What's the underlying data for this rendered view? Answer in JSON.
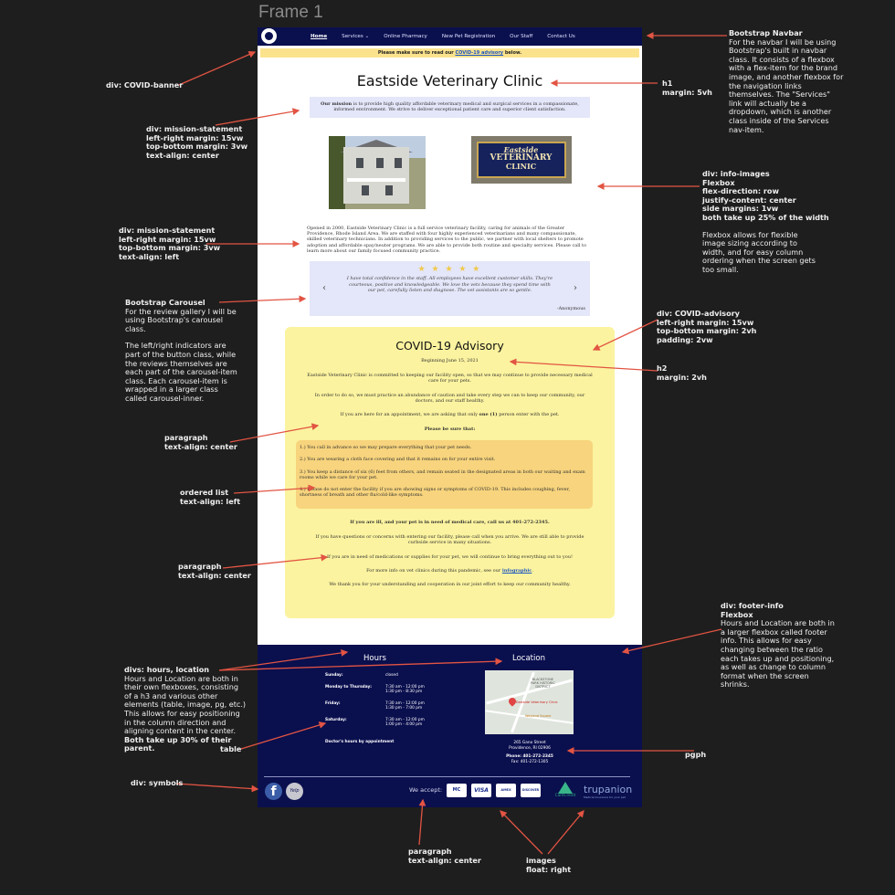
{
  "frame_title": "Frame 1",
  "site": {
    "nav": {
      "links": [
        "Home",
        "Services",
        "Online Pharmacy",
        "New Pet Registration",
        "Our Staff",
        "Contact Us"
      ]
    },
    "banner": {
      "prefix": "Please make sure to read our ",
      "link": "COVID-19 advisory",
      "suffix": " below."
    },
    "title": "Eastside Veterinary Clinic",
    "mission_label": "Our mission",
    "mission_text": " is to provide high quality affordable veterinary medical and surgical services in a compassionate, informed environment. We strive to deliver exceptional patient care and superior client satisfaction.",
    "sign": {
      "line1": "Eastside",
      "line2": "VETERINARY",
      "line3": "CLINIC"
    },
    "about": "Opened in 2000, Eastside Veterinary Clinic is a full service veterinary facility, caring for animals of the Greater Providence, Rhode Island Area. We are staffed with four highly experienced veterinarians and many compassionate, skilled veterinary technicians. In addition to providing services to the public, we partner with local shelters to promote adoption and affordable spay/neuter programs. We are able to provide both routine and specialty services. Please call to learn more about our family focused community practice.",
    "review": {
      "stars": "★ ★ ★ ★ ★",
      "quote": "I have total confidence in the staff. All employees have excellent customer skills. They're courteous, positive and knowledgeable. We love the vets because they spend time with our pet, carefully listen and diagnose. The vet assistants are so gentle.",
      "author": "-Anonymous"
    },
    "advisory": {
      "title": "COVID-19 Advisory",
      "date": "Beginning June 15, 2021",
      "p1": "Eastside Veterinary Clinic is committed to keeping our facility open, so that we may continue to provide necessary medical care for your pets.",
      "p2": "In order to do so, we must practice an abundance of caution and take every step we can to keep our community, our doctors, and our staff healthy.",
      "p3a": "If you are here for an appointment, we are asking that only ",
      "p3b": "one (1)",
      "p3c": " person enter with the pet.",
      "p4": "Please be sure that:",
      "list": [
        "1.) You call in advance so we may prepare everything that your pet needs.",
        "2.) You are wearing a cloth face covering and that it remains on for your entire visit.",
        "3.) You keep a distance of six (6) feet from others, and remain seated in the designated areas in both our waiting and exam rooms while we care for your pet.",
        "4.) Please do not enter the facility if you are showing signs or symptoms of COVID-19. This includes coughing, fever, shortness of breath and other flu/cold-like symptoms."
      ],
      "p5": "If you are ill, and your pet is in need of medical care, call us at 401-272-2345.",
      "p6": "If you have questions or concerns with entering our facility, please call when you arrive. We are still able to provide curbside service in many situations.",
      "p7": "If you are in need of medications or supplies for your pet, we will continue to bring everything out to you!",
      "p8a": "For more info on vet clinics during this pandemic, see our ",
      "p8b": "infographic",
      "p8c": ".",
      "p9": "We thank you for your understanding and cooperation in our joint effort to keep our community healthy."
    },
    "footer": {
      "hours_title": "Hours",
      "location_title": "Location",
      "hours": [
        {
          "day": "Sunday:",
          "time": "closed"
        },
        {
          "day": "Monday to Thursday:",
          "time": "7:30 am - 12:00 pm\n1:30 pm - 8:30 pm"
        },
        {
          "day": "Friday:",
          "time": "7:30 am - 12:00 pm\n1:30 pm - 7:00 pm"
        },
        {
          "day": "Saturday:",
          "time": "7:30 am - 12:00 pm\n1:00 pm - 4:00 pm"
        }
      ],
      "doctor_hours": "Doctor's hours by appointment",
      "map_labels": [
        "BLACKSTONE",
        "PARK HISTORIC",
        "DISTRICT",
        "Eastside Veterinary Clinic",
        "Wayland Square"
      ],
      "address1": "265 Gano Street",
      "address2": "Providence, RI 02906",
      "phone": "Phone: 401-272-2345",
      "fax": "Fax: 401-272-1305",
      "we_accept": "We accept:",
      "cards": [
        "MC",
        "VISA",
        "AMEX",
        "DISCOVER"
      ],
      "carecredit": "CareCredit",
      "trupanion": "trupanion",
      "trupanion_tag": "Medical insurance for your pet",
      "yelp": "Yelp",
      "fb": "f"
    }
  },
  "annotations": [
    {
      "id": "navbar",
      "lines": [
        "Bootstrap Navbar",
        "For the navbar I will be using",
        "Bootstrap's built in navbar",
        "class. It consists of a flexbox",
        "with a flex-item for the brand",
        "image, and another flexbox for",
        "the navigation links",
        "themselves. The \"Services\"",
        "link will actually be a",
        "dropdown, which is another",
        "class inside of the Services",
        "nav-item."
      ]
    },
    {
      "id": "covid-banner",
      "lines": [
        "div: COVID-banner"
      ]
    },
    {
      "id": "h1",
      "lines": [
        "h1",
        "margin: 5vh"
      ]
    },
    {
      "id": "mission-center",
      "lines": [
        "div: mission-statement",
        "left-right margin: 15vw",
        "top-bottom margin: 3vw",
        "text-align: center"
      ]
    },
    {
      "id": "info-images",
      "lines": [
        "div: info-images",
        "Flexbox",
        "flex-direction: row",
        "justify-content: center",
        "side margins: 1vw",
        "both take up 25% of the width",
        "",
        "Flexbox allows for flexible",
        "image sizing according to",
        "width, and for easy column",
        "ordering when the screen gets",
        "too small."
      ]
    },
    {
      "id": "mission-left",
      "lines": [
        "div: mission-statement",
        "left-right margin: 15vw",
        "top-bottom margin: 3vw",
        "text-align: left"
      ]
    },
    {
      "id": "carousel",
      "lines": [
        "Bootstrap Carousel",
        "For the review gallery I will be",
        "using Bootstrap's carousel",
        "class.",
        "",
        "The left/right indicators are",
        "part of the button class, while",
        "the reviews themselves are",
        "each part of the carousel-item",
        "class. Each carousel-item is",
        "wrapped in a larger class",
        "called carousel-inner."
      ]
    },
    {
      "id": "covid-advisory",
      "lines": [
        "div: COVID-advisory",
        "left-right margin: 15vw",
        "top-bottom margin: 2vh",
        "padding: 2vw"
      ]
    },
    {
      "id": "h2",
      "lines": [
        "h2",
        "margin: 2vh"
      ]
    },
    {
      "id": "paragraph-center-1",
      "lines": [
        "paragraph",
        "text-align: center"
      ]
    },
    {
      "id": "ordered-list",
      "lines": [
        "ordered list",
        "text-align: left"
      ]
    },
    {
      "id": "paragraph-center-2",
      "lines": [
        "paragraph",
        "text-align: center"
      ]
    },
    {
      "id": "footer-info",
      "lines": [
        "div: footer-info",
        "Flexbox",
        "Hours and Location are both in",
        "a larger flexbox called footer",
        "info. This allows for easy",
        "changing between the ratio",
        "each takes up and positioning,",
        "as well as change to column",
        "format when the screen",
        "shrinks."
      ]
    },
    {
      "id": "hours-location",
      "lines": [
        "divs: hours, location",
        "Hours and Location are both in",
        "their own flexboxes, consisting",
        "of a h3 and various other",
        "elements (table, image, pg, etc.)",
        "This allows for easy positioning",
        "in the column direction and",
        "aligning content in the center.",
        "Both take up 30% of their",
        "parent."
      ]
    },
    {
      "id": "table",
      "lines": [
        "table"
      ]
    },
    {
      "id": "pgph",
      "lines": [
        "pgph"
      ]
    },
    {
      "id": "symbols",
      "lines": [
        "div: symbols"
      ]
    },
    {
      "id": "paragraph-bottom",
      "lines": [
        "paragraph",
        "text-align: center"
      ]
    },
    {
      "id": "images-float",
      "lines": [
        "images",
        "float: right"
      ]
    }
  ]
}
